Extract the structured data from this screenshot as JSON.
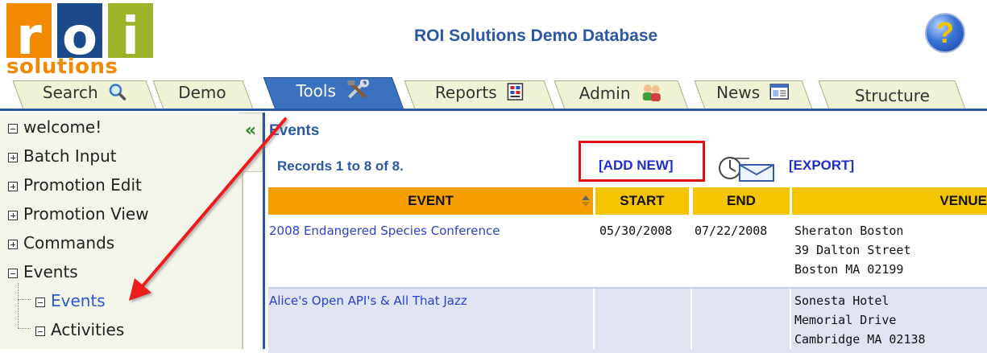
{
  "logo": {
    "letters": [
      "r",
      "o",
      "i"
    ],
    "word": "solutions"
  },
  "header": {
    "title": "ROI Solutions Demo Database",
    "help_symbol": "?"
  },
  "tabs": [
    {
      "label": "Search",
      "icon": "magnifier-icon",
      "active": false
    },
    {
      "label": "Demo",
      "icon": "",
      "active": false
    },
    {
      "label": "Tools",
      "icon": "tools-icon",
      "active": true
    },
    {
      "label": "Reports",
      "icon": "report-icon",
      "active": false
    },
    {
      "label": "Admin",
      "icon": "users-icon",
      "active": false
    },
    {
      "label": "News",
      "icon": "news-icon",
      "active": false
    },
    {
      "label": "Structure",
      "icon": "",
      "active": false
    }
  ],
  "sidebar": {
    "collapse_symbol": "«",
    "items": [
      {
        "label": "welcome!",
        "expander": "none"
      },
      {
        "label": "Batch Input",
        "expander": "plus"
      },
      {
        "label": "Promotion Edit",
        "expander": "plus"
      },
      {
        "label": "Promotion View",
        "expander": "plus"
      },
      {
        "label": "Commands",
        "expander": "plus"
      },
      {
        "label": "Events",
        "expander": "minus"
      },
      {
        "label": "Events",
        "expander": "none",
        "child": true,
        "selected": true
      },
      {
        "label": "Activities",
        "expander": "none",
        "child": true
      }
    ]
  },
  "main": {
    "title": "Events",
    "records": "Records 1 to 8 of 8.",
    "add_new": "[ADD NEW]",
    "export": "[EXPORT]"
  },
  "table": {
    "headers": [
      "EVENT",
      "START",
      "END",
      "VENUE"
    ],
    "rows": [
      {
        "event": "2008 Endangered Species Conference",
        "start": "05/30/2008",
        "end": "07/22/2008",
        "venue": [
          "Sheraton Boston",
          "39 Dalton Street",
          "Boston MA 02199"
        ]
      },
      {
        "event": "Alice's Open API's & All That Jazz",
        "start": "",
        "end": "",
        "venue": [
          "Sonesta Hotel",
          "Memorial Drive",
          "Cambridge MA 02138"
        ]
      }
    ]
  },
  "colors": {
    "brand_orange": "#f18a00",
    "brand_blue": "#1b4a8c",
    "brand_green": "#9db42a",
    "header_blue": "#2a58a6",
    "event_header": "#f5a000",
    "col_header": "#f5c400",
    "annotation_red": "#e01010"
  }
}
